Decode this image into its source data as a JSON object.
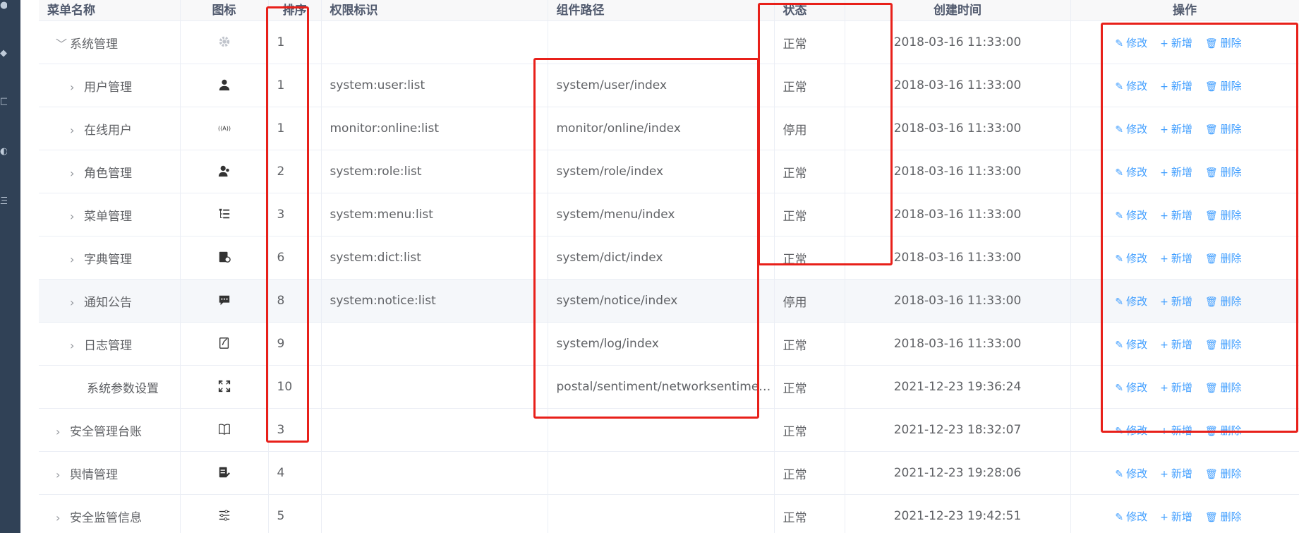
{
  "columns": {
    "name": "菜单名称",
    "icon": "图标",
    "order": "排序",
    "perm": "权限标识",
    "component": "组件路径",
    "status": "状态",
    "created": "创建时间",
    "ops": "操作"
  },
  "actions": {
    "edit": "修改",
    "add": "新增",
    "delete": "删除"
  },
  "rows": [
    {
      "name": "系统管理",
      "arrow": "﹀",
      "icon": "gear-icon",
      "order": "1",
      "perm": "",
      "component": "",
      "status": "正常",
      "created": "2018-03-16 11:33:00"
    },
    {
      "name": "用户管理",
      "arrow": "›",
      "icon": "user-icon",
      "order": "1",
      "perm": "system:user:list",
      "component": "system/user/index",
      "status": "正常",
      "created": "2018-03-16 11:33:00"
    },
    {
      "name": "在线用户",
      "arrow": "›",
      "icon": "online-icon",
      "order": "1",
      "perm": "monitor:online:list",
      "component": "monitor/online/index",
      "status": "停用",
      "created": "2018-03-16 11:33:00"
    },
    {
      "name": "角色管理",
      "arrow": "›",
      "icon": "peoples-icon",
      "order": "2",
      "perm": "system:role:list",
      "component": "system/role/index",
      "status": "正常",
      "created": "2018-03-16 11:33:00"
    },
    {
      "name": "菜单管理",
      "arrow": "›",
      "icon": "tree-table-icon",
      "order": "3",
      "perm": "system:menu:list",
      "component": "system/menu/index",
      "status": "正常",
      "created": "2018-03-16 11:33:00"
    },
    {
      "name": "字典管理",
      "arrow": "›",
      "icon": "dict-icon",
      "order": "6",
      "perm": "system:dict:list",
      "component": "system/dict/index",
      "status": "正常",
      "created": "2018-03-16 11:33:00"
    },
    {
      "name": "通知公告",
      "arrow": "›",
      "icon": "message-icon",
      "order": "8",
      "perm": "system:notice:list",
      "component": "system/notice/index",
      "status": "停用",
      "created": "2018-03-16 11:33:00"
    },
    {
      "name": "日志管理",
      "arrow": "›",
      "icon": "log-icon",
      "order": "9",
      "perm": "",
      "component": "system/log/index",
      "status": "正常",
      "created": "2018-03-16 11:33:00"
    },
    {
      "name": "系统参数设置",
      "arrow": "",
      "icon": "fullscreen-icon",
      "order": "10",
      "perm": "",
      "component": "postal/sentiment/networksentiment/...",
      "status": "正常",
      "created": "2021-12-23 19:36:24"
    },
    {
      "name": "安全管理台账",
      "arrow": "›",
      "icon": "book-icon",
      "order": "3",
      "perm": "",
      "component": "",
      "status": "正常",
      "created": "2021-12-23 18:32:07"
    },
    {
      "name": "舆情管理",
      "arrow": "›",
      "icon": "form-icon",
      "order": "4",
      "perm": "",
      "component": "",
      "status": "正常",
      "created": "2021-12-23 19:28:06"
    },
    {
      "name": "安全监管信息",
      "arrow": "›",
      "icon": "sliders-icon",
      "order": "5",
      "perm": "",
      "component": "",
      "status": "正常",
      "created": "2021-12-23 19:42:51"
    }
  ],
  "colors": {
    "link": "#409eff",
    "highlight": "#e8201a",
    "sidebar": "#304156"
  }
}
